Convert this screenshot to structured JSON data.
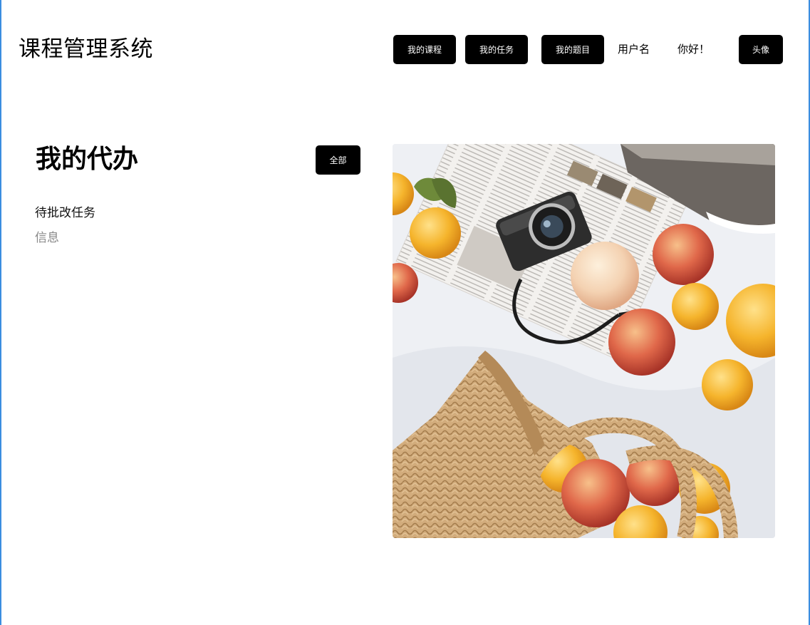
{
  "header": {
    "app_title": "课程管理系统",
    "nav": {
      "my_courses": "我的课程",
      "my_tasks": "我的任务",
      "my_questions": "我的题目"
    },
    "username": "用户名",
    "greeting": "你好！",
    "avatar_label": "头像"
  },
  "todo": {
    "title": "我的代办",
    "all_button": "全部",
    "items": [
      "待批改任务",
      "信息"
    ]
  },
  "photo": {
    "icon": "picnic-photo"
  },
  "colors": {
    "button_bg": "#000000",
    "button_text": "#ffffff",
    "frame_border": "#3b8de0",
    "muted_text": "#888888"
  }
}
